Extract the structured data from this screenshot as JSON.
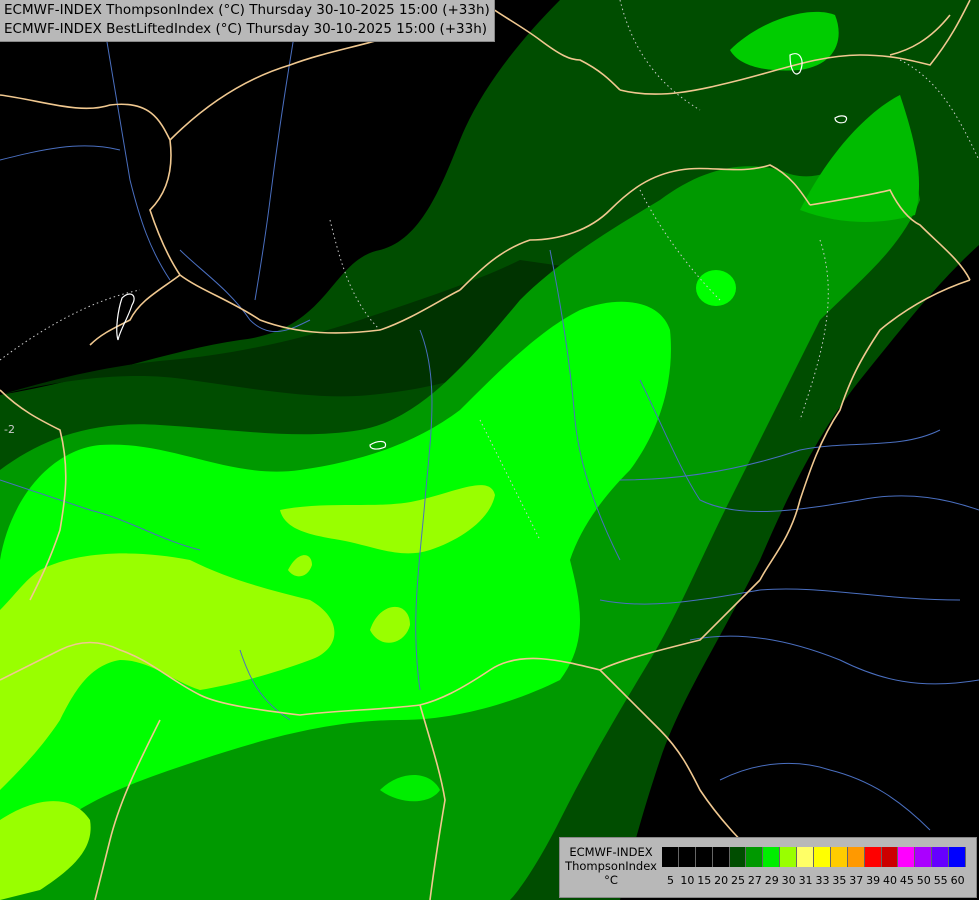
{
  "title": {
    "line1": "ECMWF-INDEX ThompsonIndex (°C) Thursday 30-10-2025 15:00 (+33h)",
    "line2": "ECMWF-INDEX BestLiftedIndex (°C) Thursday 30-10-2025 15:00 (+33h)"
  },
  "legend": {
    "title": "ECMWF-INDEX",
    "variable": "ThompsonIndex",
    "unit": "°C",
    "ticks": [
      "5",
      "10",
      "15",
      "20",
      "25",
      "27",
      "29",
      "30",
      "31",
      "33",
      "35",
      "37",
      "39",
      "40",
      "45",
      "50",
      "55",
      "60"
    ],
    "colors": [
      "#000000",
      "#000000",
      "#000000",
      "#000000",
      "#004d00",
      "#009900",
      "#00ee00",
      "#99ff00",
      "#ffff66",
      "#ffff00",
      "#ffcc00",
      "#ff9900",
      "#ff0000",
      "#cc0000",
      "#ff00ff",
      "#aa00ff",
      "#6600ff",
      "#0000ff"
    ]
  },
  "map_colors": {
    "background": "#000000",
    "dark_green": "#004d00",
    "mid_green": "#009900",
    "bright_green": "#00ff00",
    "yellow_green": "#99ff00",
    "borders": "#f0c890",
    "rivers": "#4a6fc0",
    "contours": "#cccccc"
  },
  "map_labels": [
    "-2"
  ]
}
